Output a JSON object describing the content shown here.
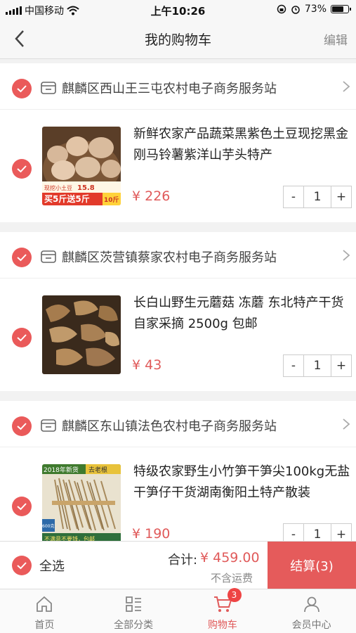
{
  "status_bar": {
    "carrier": "中国移动",
    "time": "上午10:26",
    "battery": "73%",
    "battery_level": 0.73
  },
  "nav": {
    "title": "我的购物车",
    "edit_label": "编辑",
    "back_icon": "chevron-left-icon"
  },
  "stores": [
    {
      "name": "麒麟区西山王三屯农村电子商务服务站",
      "item": {
        "title": "新鲜农家产品蔬菜黑紫色土豆现挖黑金刚马铃薯紫洋山芋头特产",
        "price": "¥ 226",
        "qty": "1",
        "image_text": {
          "tag1": "现挖小土豆",
          "tag1_price": "15.8",
          "promo": "买5斤送5斤",
          "promo_extra": "10斤"
        }
      }
    },
    {
      "name": "麒麟区茨营镇蔡家农村电子商务服务站",
      "item": {
        "title": "长白山野生元蘑菇 冻蘑 东北特产干货 自家采摘 2500g 包邮",
        "price": "¥ 43",
        "qty": "1"
      }
    },
    {
      "name": "麒麟区东山镇法色农村电子商务服务站",
      "item": {
        "title": "特级农家野生小竹笋干笋尖100kg无盐干笋仔干货湖南衡阳土特产散装",
        "price": "¥ 190",
        "qty": "1",
        "image_text": {
          "tag1": "2018年新货",
          "tag2": "去老根",
          "price_tag": "600克",
          "bottom": "不满意不要钱，包邮"
        }
      }
    }
  ],
  "stepper": {
    "minus": "-",
    "plus": "+"
  },
  "checkout": {
    "select_all": "全选",
    "total_label": "合计:",
    "total_value": "¥ 459.00",
    "shipping_note": "不含运费",
    "button": "结算(3)"
  },
  "tabs": [
    {
      "label": "首页",
      "icon": "home-icon"
    },
    {
      "label": "全部分类",
      "icon": "category-icon"
    },
    {
      "label": "购物车",
      "icon": "cart-icon",
      "badge": "3",
      "active": true
    },
    {
      "label": "会员中心",
      "icon": "user-icon"
    }
  ],
  "colors": {
    "accent": "#e55b5b",
    "price": "#e05a5a"
  }
}
